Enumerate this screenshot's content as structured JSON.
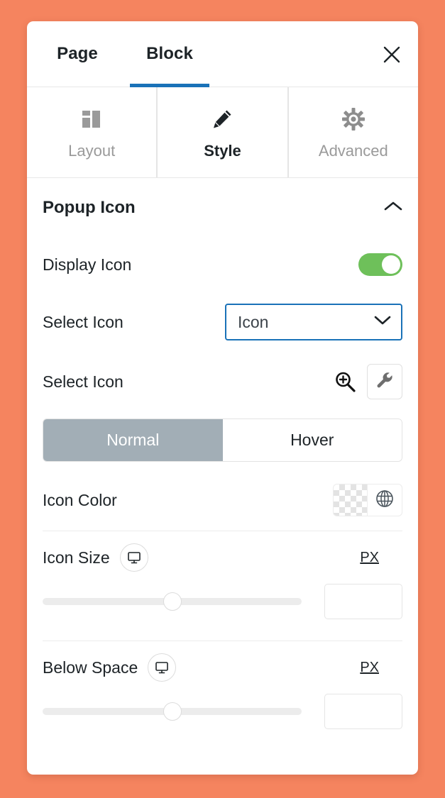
{
  "theme": {
    "backdrop_color": "#F5845F",
    "panel_color": "#FFFFFF",
    "accent_blue": "#1A72B8",
    "toggle_on_color": "#6EC05A",
    "segment_active_color": "#A2AEB6"
  },
  "top_tabs": {
    "page_label": "Page",
    "block_label": "Block",
    "active": "Block",
    "close_icon": "close-icon"
  },
  "section_tabs": [
    {
      "label": "Layout",
      "icon": "columns-layout-icon",
      "active": false
    },
    {
      "label": "Style",
      "icon": "pencil-icon",
      "active": true
    },
    {
      "label": "Advanced",
      "icon": "gear-icon",
      "active": false
    }
  ],
  "panel": {
    "section_title": "Popup Icon",
    "collapse_icon": "chevron-up-icon",
    "display_icon": {
      "label": "Display Icon",
      "toggle_state": "on"
    },
    "select_icon_dropdown": {
      "label": "Select Icon",
      "value": "Icon",
      "chevron_icon": "chevron-down-icon",
      "focused": true
    },
    "select_icon_picker": {
      "label": "Select Icon",
      "search_icon": "magnifier-plus-icon",
      "tool_icon": "wrench-icon"
    },
    "state_tabs": {
      "normal_label": "Normal",
      "hover_label": "Hover",
      "active": "Normal"
    },
    "icon_color": {
      "label": "Icon Color",
      "swatch": "transparent-checkerboard-swatch",
      "globe_icon": "globe-icon"
    },
    "icon_size": {
      "label": "Icon Size",
      "device_icon": "desktop-monitor-icon",
      "unit": "PX",
      "value": "",
      "placeholder": "",
      "slider_percent": 50
    },
    "below_space": {
      "label": "Below Space",
      "device_icon": "desktop-monitor-icon",
      "unit": "PX",
      "value": "",
      "placeholder": "",
      "slider_percent": 50
    }
  }
}
